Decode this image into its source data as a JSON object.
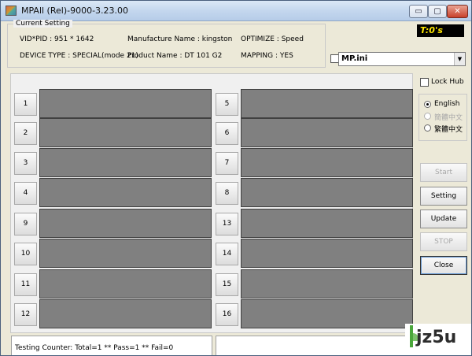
{
  "window": {
    "title": "MPAll (Rel)-9000-3.23.00",
    "controls": {
      "minimize": "▭",
      "maximize": "▢",
      "close": "✕"
    }
  },
  "current_setting": {
    "legend": "Current Setting",
    "vid_pid": "VID*PID :  951 * 1642",
    "manufacture_name": "Manufacture Name : kingston",
    "optimize": "OPTIMIZE : Speed",
    "device_type": "DEVICE TYPE : SPECIAL(mode 21)",
    "product_name": "Product Name : DT 101 G2",
    "mapping": "MAPPING : YES"
  },
  "timer": "T:0's",
  "ini_file": {
    "checked": false,
    "value": "MP.ini"
  },
  "lock_hub": {
    "label": "Lock Hub",
    "checked": false
  },
  "languages": [
    {
      "label": "English",
      "selected": true,
      "enabled": true
    },
    {
      "label": "簡體中文",
      "selected": false,
      "enabled": false
    },
    {
      "label": "繁體中文",
      "selected": false,
      "enabled": true
    }
  ],
  "buttons": {
    "start": "Start",
    "setting": "Setting",
    "update": "Update",
    "stop": "STOP",
    "close": "Close"
  },
  "slots": [
    "1",
    "2",
    "3",
    "4",
    "5",
    "6",
    "7",
    "8",
    "9",
    "10",
    "11",
    "12",
    "13",
    "14",
    "15",
    "16"
  ],
  "status": {
    "counter": "Testing Counter: Total=1 ** Pass=1 ** Fail=0"
  },
  "watermark": {
    "brand": "jz5u"
  },
  "colors": {
    "timer_bg": "#000000",
    "timer_fg": "#ffe800",
    "slot_bar": "#808080"
  }
}
